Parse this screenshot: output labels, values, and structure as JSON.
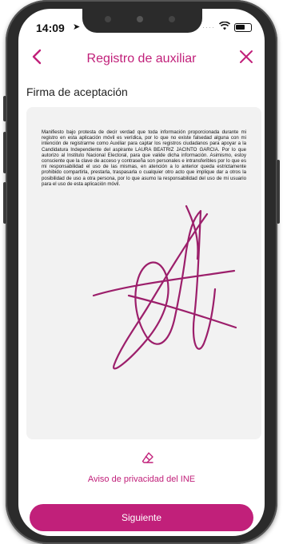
{
  "status_bar": {
    "time": "14:09",
    "location_icon": "location-arrow-icon",
    "wifi_icon": "wifi-icon",
    "battery_icon": "battery-icon"
  },
  "nav": {
    "back_icon": "chevron-left-icon",
    "title": "Registro de auxiliar",
    "close_icon": "close-icon"
  },
  "section": {
    "title": "Firma de aceptación"
  },
  "signature": {
    "declaration": "Manifiesto bajo protesta de decir verdad que toda información proporcionada durante mi registro en esta aplicación móvil es verídica, por lo que no existe falsedad alguna con mi intención de registrarme como Auxiliar para captar los registros ciudadanos para apoyar a la Candidatura Independiente del aspirante LAURA BEATRIZ JACINTO GARCIA. Por lo que autorizo al Instituto Nacional Electoral, para que valide dicha información. Asimismo, estoy consciente que la clave de acceso y contraseña son personales e intransferibles por lo que es mi responsabilidad el uso de las mismas, en atención a lo anterior queda estrictamente prohibido compartirla, prestarla, traspasarla o cualquier otro acto que implique dar a otros la posibilidad de uso a otra persona, por lo que asumo la responsabilidad del uso de mi usuario para el uso de esta aplicación móvil.",
    "stroke_color": "#9c1f6b",
    "eraser_icon": "eraser-icon"
  },
  "footer": {
    "privacy_link": "Aviso de privacidad del INE",
    "next_button": "Siguiente"
  },
  "colors": {
    "accent": "#c1207a",
    "card_background": "#f2f2f2"
  }
}
